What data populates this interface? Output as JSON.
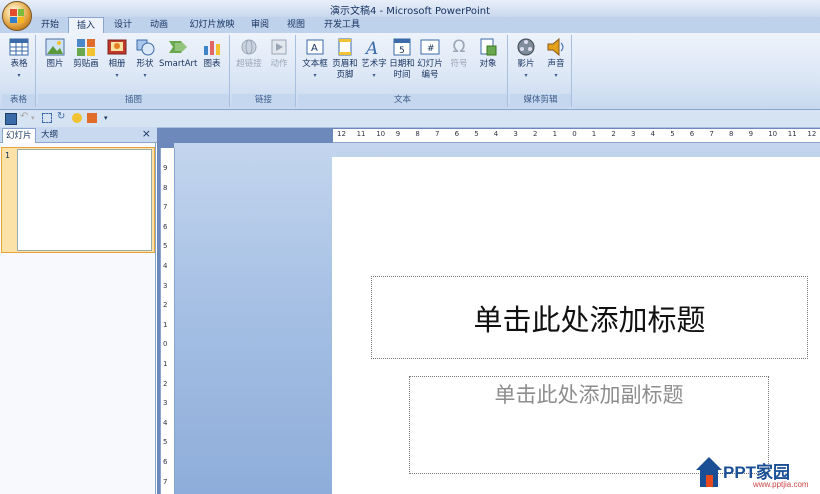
{
  "window": {
    "title": "演示文稿4 - Microsoft PowerPoint"
  },
  "tabs": [
    "开始",
    "插入",
    "设计",
    "动画",
    "幻灯片放映",
    "审阅",
    "视图",
    "开发工具"
  ],
  "active_tab": "插入",
  "ribbon": {
    "groups": {
      "tables": {
        "label": "表格",
        "buttons": {
          "table": "表格"
        }
      },
      "illustrations": {
        "label": "插图",
        "buttons": {
          "picture": "图片",
          "clipart": "剪贴画",
          "album": "相册",
          "shapes": "形状",
          "smartart": "SmartArt",
          "chart": "图表"
        }
      },
      "links": {
        "label": "链接",
        "buttons": {
          "hyperlink": "超链接",
          "action": "动作"
        }
      },
      "text": {
        "label": "文本",
        "buttons": {
          "textbox": "文本框",
          "header1": "页眉和",
          "header2": "页脚",
          "wordart": "艺术字",
          "datetime1": "日期和",
          "datetime2": "时间",
          "slidenum1": "幻灯片",
          "slidenum2": "编号",
          "symbol": "符号",
          "object": "对象"
        }
      },
      "media": {
        "label": "媒体剪辑",
        "buttons": {
          "movie": "影片",
          "sound": "声音"
        }
      }
    }
  },
  "slide_pane": {
    "tab_slides": "幻灯片",
    "tab_outline": "大纲",
    "close": "×",
    "slide_number": "1"
  },
  "slide": {
    "title_placeholder": "单击此处添加标题",
    "subtitle_placeholder": "单击此处添加副标题"
  },
  "hruler_ticks": [
    "12",
    "11",
    "10",
    "9",
    "8",
    "7",
    "6",
    "5",
    "4",
    "3",
    "2",
    "1",
    "0",
    "1",
    "2",
    "3",
    "4",
    "5",
    "6",
    "7",
    "8",
    "9",
    "10",
    "11",
    "12"
  ],
  "vruler_ticks": [
    "9",
    "8",
    "7",
    "6",
    "5",
    "4",
    "3",
    "2",
    "1",
    "0",
    "1",
    "2",
    "3",
    "4",
    "5",
    "6",
    "7"
  ],
  "watermark": {
    "brand": "PPT家园",
    "url": "www.pptjia.com"
  },
  "colors": {
    "ribbon": "#dbe6f5",
    "workarea": "#a9c2e5",
    "thumbnail_selected": "#fde2a8"
  }
}
